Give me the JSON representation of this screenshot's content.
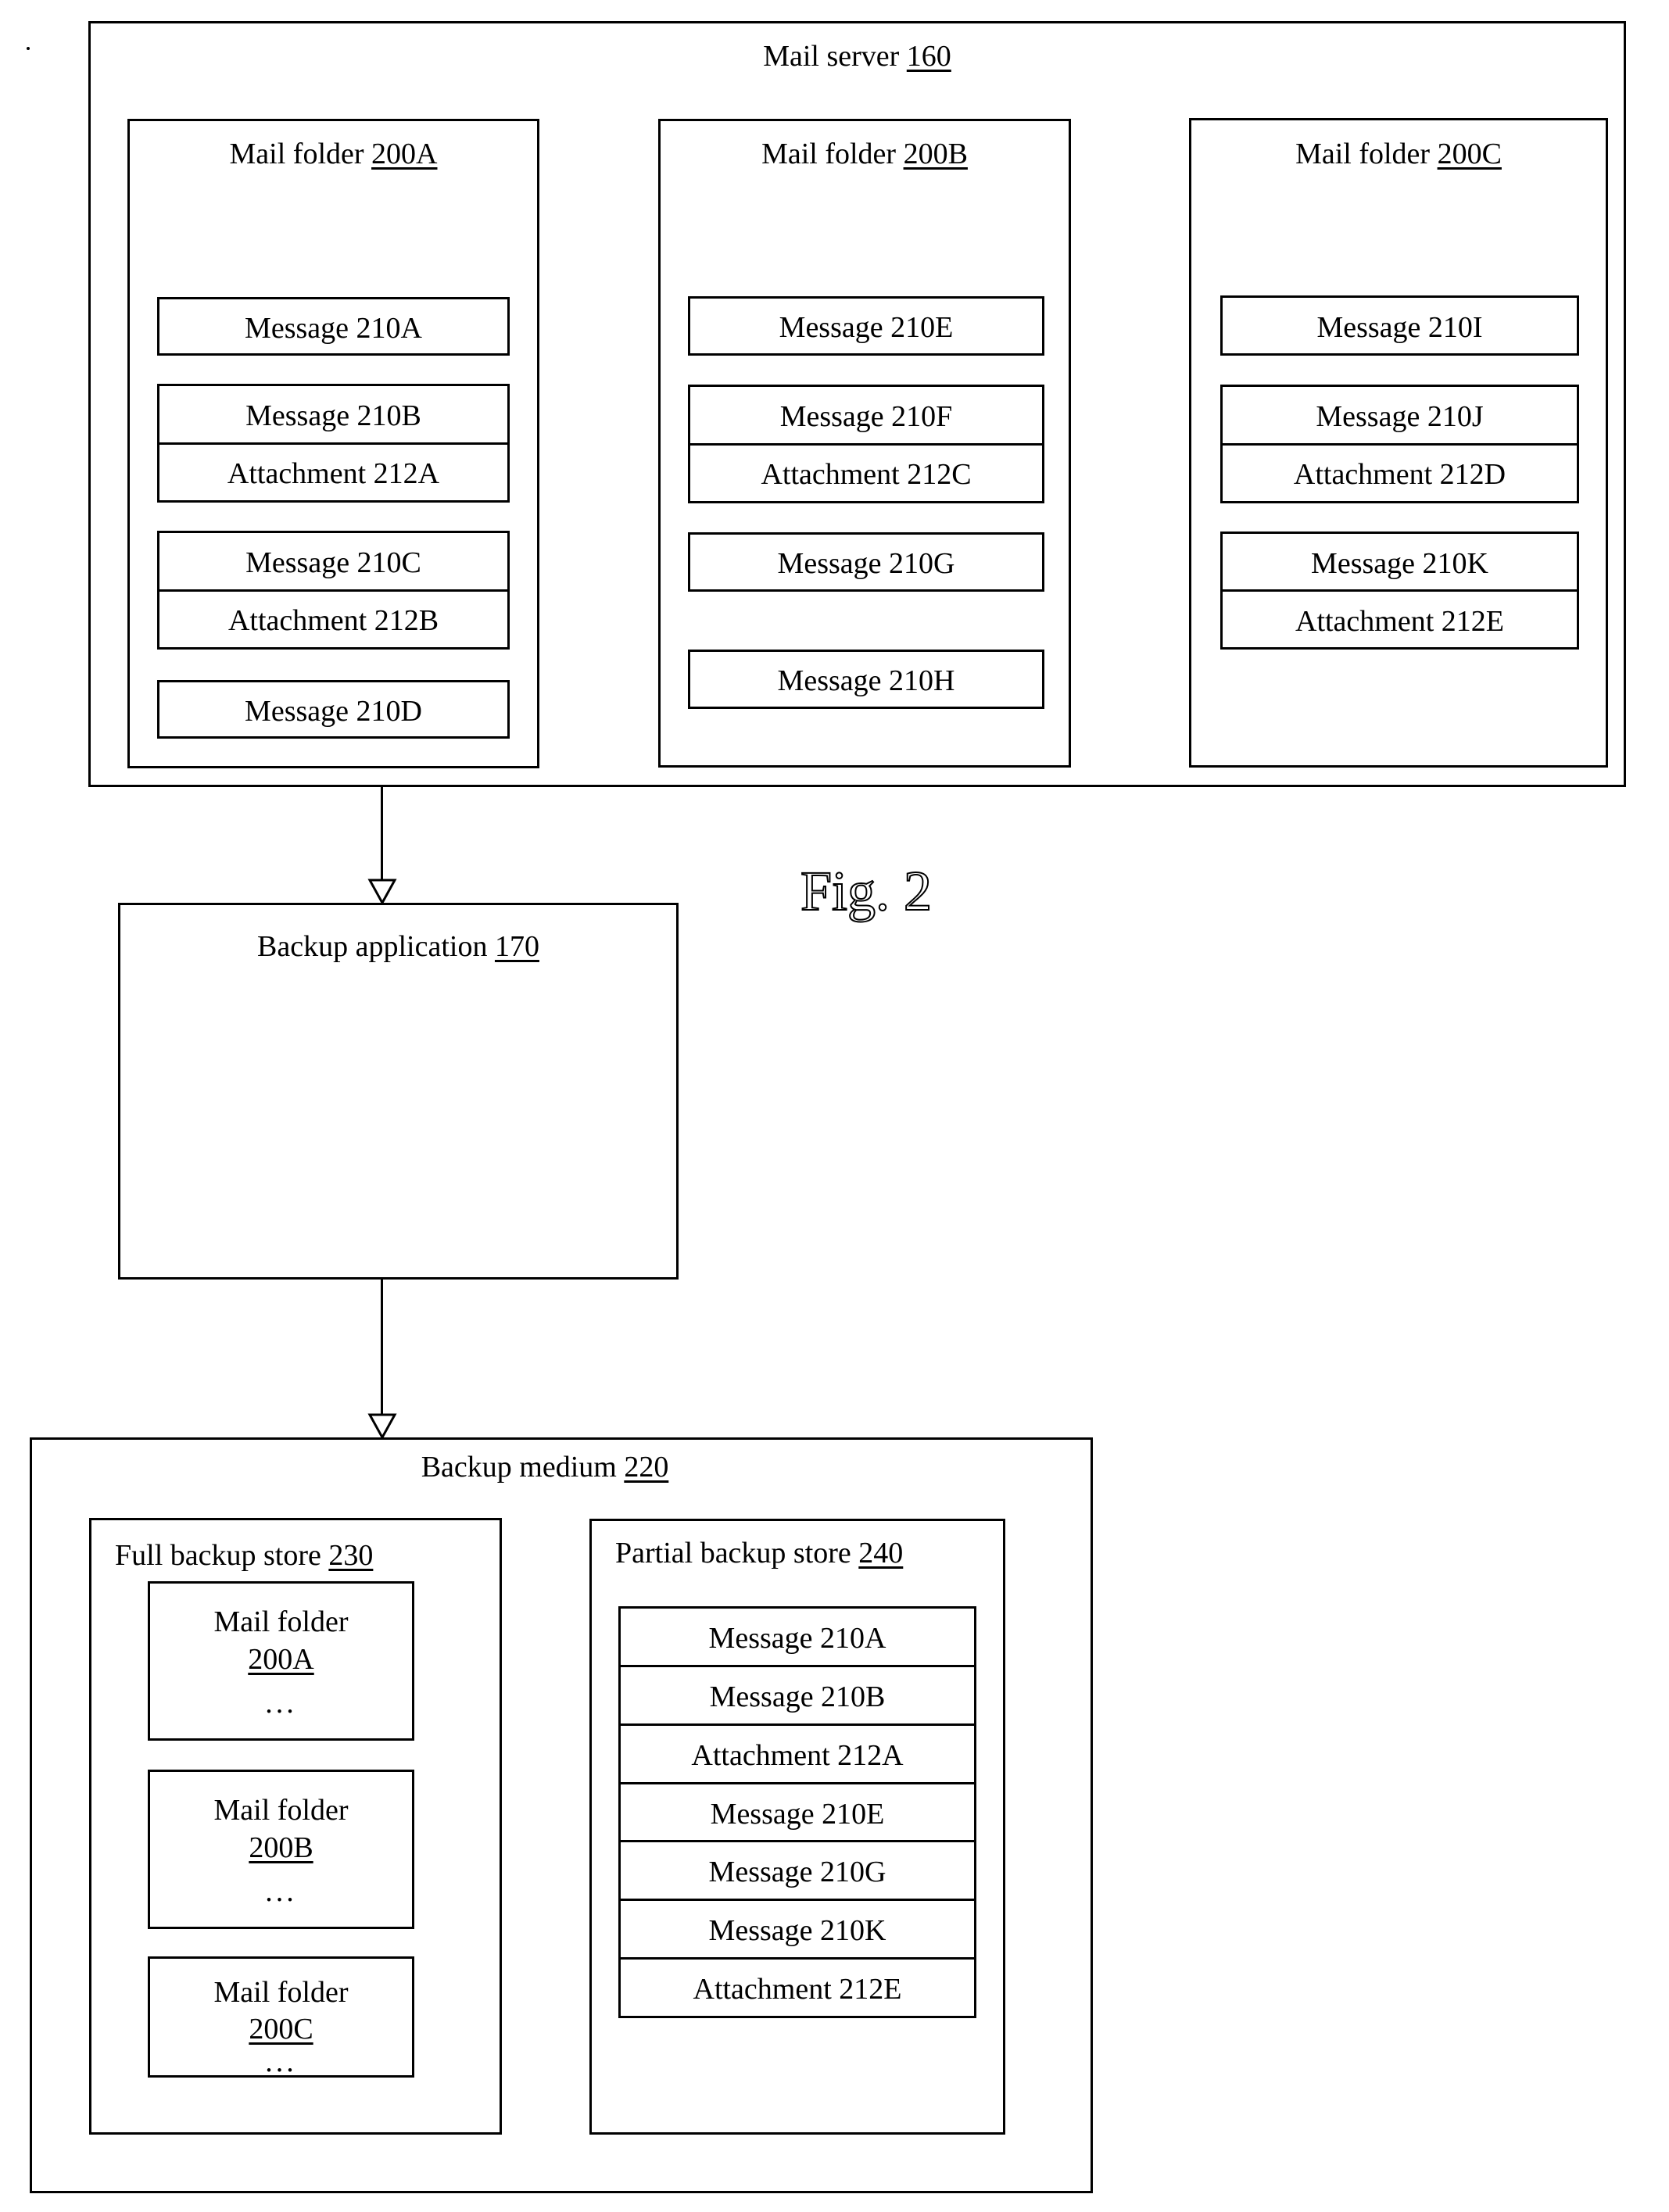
{
  "figure_label": "Fig. 2",
  "mail_server": {
    "label": "Mail server ",
    "ref": "160",
    "folders": [
      {
        "label": "Mail folder ",
        "ref": "200A",
        "groups": [
          [
            "Message 210A"
          ],
          [
            "Message 210B",
            "Attachment 212A"
          ],
          [
            "Message 210C",
            "Attachment 212B"
          ],
          [
            "Message 210D"
          ]
        ]
      },
      {
        "label": "Mail folder ",
        "ref": "200B",
        "groups": [
          [
            "Message 210E"
          ],
          [
            "Message 210F",
            "Attachment 212C"
          ],
          [
            "Message 210G"
          ],
          [
            "Message 210H"
          ]
        ]
      },
      {
        "label": "Mail folder ",
        "ref": "200C",
        "groups": [
          [
            "Message 210I"
          ],
          [
            "Message 210J",
            "Attachment 212D"
          ],
          [
            "Message 210K",
            "Attachment 212E"
          ]
        ]
      }
    ]
  },
  "backup_application": {
    "label": "Backup application ",
    "ref": "170"
  },
  "backup_medium": {
    "label": "Backup medium ",
    "ref": "220",
    "full_store": {
      "label": "Full backup store ",
      "ref": "230",
      "folders": [
        {
          "label": "Mail folder",
          "ref": "200A",
          "ellipsis": "..."
        },
        {
          "label": "Mail folder",
          "ref": "200B",
          "ellipsis": "..."
        },
        {
          "label": "Mail folder",
          "ref": "200C",
          "ellipsis": "..."
        }
      ]
    },
    "partial_store": {
      "label": "Partial backup store ",
      "ref": "240",
      "items": [
        "Message 210A",
        "Message 210B",
        "Attachment 212A",
        "Message 210E",
        "Message 210G",
        "Message 210K",
        "Attachment 212E"
      ]
    }
  }
}
